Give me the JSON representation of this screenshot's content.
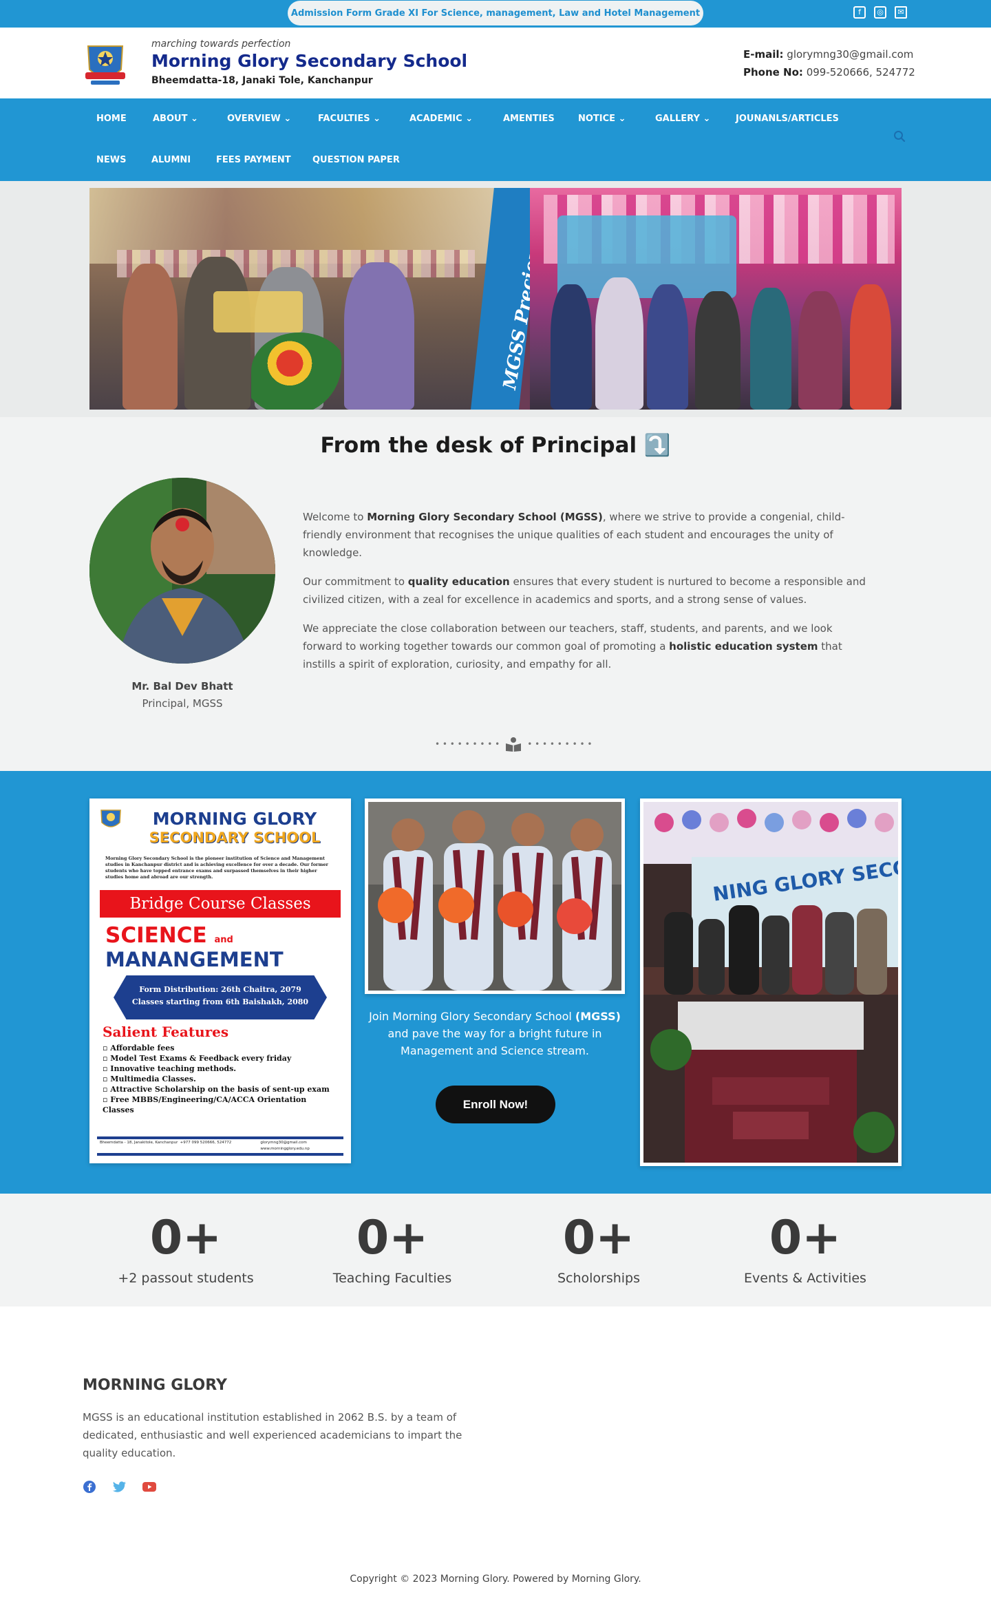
{
  "topbar": {
    "admission_text": "Admission Form Grade XI For Science, management, Law and Hotel Management",
    "icons": [
      "facebook-icon",
      "instagram-icon",
      "mail-icon"
    ]
  },
  "header": {
    "tagline": "marching towards perfection",
    "school_name": "Morning Glory Secondary School",
    "address": "Bheemdatta-18, Janaki Tole, Kanchanpur",
    "email_label": "E-mail:",
    "email_value": "glorymng30@gmail.com",
    "phone_label": "Phone No:",
    "phone_value": "099-520666, 524772"
  },
  "nav": {
    "items": [
      {
        "label": "HOME"
      },
      {
        "label": "ABOUT"
      },
      {
        "label": "OVERVIEW"
      },
      {
        "label": "FACULTIES"
      },
      {
        "label": "ACADEMIC"
      },
      {
        "label": "AMENTIES"
      },
      {
        "label": "NOTICE"
      },
      {
        "label": "GALLERY"
      },
      {
        "label": "JOUNANLS/ARTICLES"
      },
      {
        "label": "NEWS"
      },
      {
        "label": "ALUMNI"
      },
      {
        "label": "FEES PAYMENT"
      },
      {
        "label": "QUESTION PAPER"
      }
    ]
  },
  "hero": {
    "band_text": "MGSS Precious Moments"
  },
  "principal": {
    "heading": "From the desk of Principal ⤵️",
    "name": "Mr. Bal Dev Bhatt",
    "role": "Principal, MGSS",
    "p1_a": "Welcome to ",
    "p1_b": "Morning Glory Secondary School (MGSS)",
    "p1_c": ", where we strive to provide a congenial, child-friendly environment that recognises the unique qualities of each student and encourages the unity of knowledge.",
    "p2_a": "Our commitment to ",
    "p2_b": "quality education",
    "p2_c": " ensures that every student is nurtured to become a responsible and civilized citizen, with a zeal for excellence in academics and sports, and a strong sense of values.",
    "p3_a": "We appreciate the close collaboration between our teachers, staff, students, and parents, and we look forward to working together towards our common goal of promoting a ",
    "p3_b": "holistic education system",
    "p3_c": " that instills a spirit of exploration, curiosity, and empathy for all."
  },
  "poster": {
    "title1": "MORNING GLORY",
    "title2": "SECONDARY SCHOOL",
    "intro": "Morning Glory Secondary School is the pioneer institution of Science and Management studies in Kanchanpur district and is achieving excellence for over a decade. Our former students who have topped entrance exams and surpassed themselves in their higher studies home and abroad are our strength.",
    "banner": "Bridge Course Classes",
    "science": "SCIENCE",
    "and": "and",
    "management": "MANANGEMENT",
    "form_dist": "Form Distribution: 26th Chaitra, 2079",
    "classes_start": "Classes starting from 6th Baishakh, 2080",
    "features_title": "Salient Features",
    "features": [
      "Affordable fees",
      "Model Test Exams & Feedback every friday",
      "Innovative teaching methods.",
      "Multimedia Classes.",
      "Attractive Scholarship on the basis of sent-up exam",
      "Free MBBS/Engineering/CA/ACCA Orientation Classes"
    ],
    "footer_addr": "Bheemdatta - 18, Janakitole, Kanchanpur",
    "footer_phone": "+977 099 520666, 524772",
    "footer_email": "glorymng30@gmail.com",
    "footer_web": "www.morningglory.edu.np"
  },
  "promo": {
    "text_a": "Join Morning Glory Secondary School ",
    "text_b": "(MGSS)",
    "text_c": " and pave the way for a bright future in Management and Science stream.",
    "button": "Enroll Now!",
    "awards_banner": "NING GLORY SECONDA"
  },
  "stats": [
    {
      "number": "0+",
      "label": "+2 passout students"
    },
    {
      "number": "0+",
      "label": "Teaching Faculties"
    },
    {
      "number": "0+",
      "label": "Scholorships"
    },
    {
      "number": "0+",
      "label": "Events & Activities"
    }
  ],
  "footer": {
    "title": "MORNING GLORY",
    "text": "MGSS is an educational institution established in 2062 B.S. by a team of dedicated, enthusiastic and well experienced academicians to impart the quality education.",
    "social": [
      "facebook-icon",
      "twitter-icon",
      "youtube-icon"
    ],
    "copyright": "Copyright © 2023 Morning Glory. Powered by Morning Glory."
  },
  "colors": {
    "primary": "#2196d3",
    "navy": "#142a8c",
    "dark": "#111111",
    "light_bg": "#f2f3f3"
  }
}
